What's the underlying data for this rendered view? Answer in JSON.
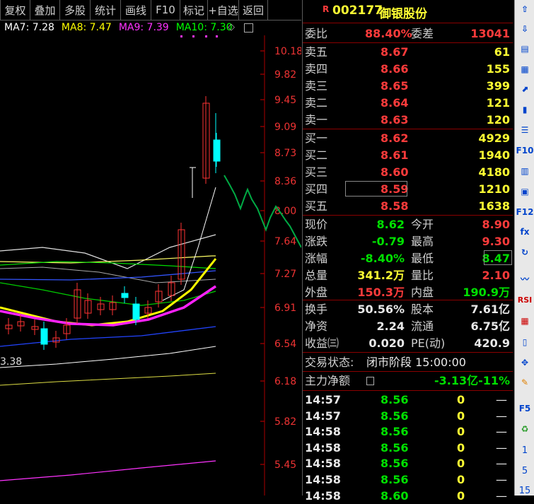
{
  "toolbar": [
    "复权",
    "叠加",
    "多股",
    "统计",
    "画线",
    "F10",
    "标记",
    "+自选",
    "返回"
  ],
  "ma": {
    "ma7": "MA7: 7.28",
    "ma8": "MA8: 7.47",
    "ma9": "MA9: 7.39",
    "ma10": "MA10: 7.30",
    "ma7_color": "#ffffff",
    "ma8_color": "#ffff00",
    "ma9_color": "#ff33ff",
    "ma10_color": "#00ff00"
  },
  "price_ticks": [
    "10.18",
    "9.82",
    "9.45",
    "9.09",
    "8.73",
    "8.36",
    "8.00",
    "7.64",
    "7.27",
    "6.91",
    "6.54",
    "6.18",
    "5.82",
    "5.45"
  ],
  "chart_low_label": "3.38",
  "stock": {
    "badge": "R",
    "code": "002177",
    "name": "御银股份"
  },
  "weibi": {
    "label1": "委比",
    "val1": "88.40%",
    "label2": "委差",
    "val2": "13041"
  },
  "sell": [
    {
      "label": "卖五",
      "price": "8.67",
      "vol": "61"
    },
    {
      "label": "卖四",
      "price": "8.66",
      "vol": "155"
    },
    {
      "label": "卖三",
      "price": "8.65",
      "vol": "399"
    },
    {
      "label": "卖二",
      "price": "8.64",
      "vol": "121"
    },
    {
      "label": "卖一",
      "price": "8.63",
      "vol": "120"
    }
  ],
  "buy": [
    {
      "label": "买一",
      "price": "8.62",
      "vol": "4929"
    },
    {
      "label": "买二",
      "price": "8.61",
      "vol": "1940"
    },
    {
      "label": "买三",
      "price": "8.60",
      "vol": "4180"
    },
    {
      "label": "买四",
      "price": "8.59",
      "vol": "1210"
    },
    {
      "label": "买五",
      "price": "8.58",
      "vol": "1638"
    }
  ],
  "quote": [
    {
      "l1": "现价",
      "v1": "8.62",
      "l2": "今开",
      "v2": "8.90"
    },
    {
      "l1": "涨跌",
      "v1": "-0.79",
      "l2": "最高",
      "v2": "9.30"
    },
    {
      "l1": "涨幅",
      "v1": "-8.40%",
      "l2": "最低",
      "v2": "8.47"
    },
    {
      "l1": "总量",
      "v1": "341.2万",
      "l2": "量比",
      "v2": "2.10"
    },
    {
      "l1": "外盘",
      "v1": "150.3万",
      "l2": "内盘",
      "v2": "190.9万"
    }
  ],
  "fin": [
    {
      "l1": "换手",
      "v1": "50.56%",
      "l2": "股本",
      "v2": "7.61亿"
    },
    {
      "l1": "净资",
      "v1": "2.24",
      "l2": "流通",
      "v2": "6.75亿"
    },
    {
      "l1": "收益㈢",
      "v1": "0.020",
      "l2": "PE(动)",
      "v2": "420.9"
    }
  ],
  "status": {
    "label": "交易状态:",
    "value": "闭市阶段 15:00:00"
  },
  "mainflow": {
    "label": "主力净额",
    "amount": "-3.13亿",
    "pct": "-11%"
  },
  "ticks": [
    {
      "time": "14:57",
      "price": "8.56",
      "vol": "0",
      "flag": "—"
    },
    {
      "time": "14:57",
      "price": "8.56",
      "vol": "0",
      "flag": "—"
    },
    {
      "time": "14:58",
      "price": "8.56",
      "vol": "0",
      "flag": "—"
    },
    {
      "time": "14:58",
      "price": "8.56",
      "vol": "0",
      "flag": "—"
    },
    {
      "time": "14:58",
      "price": "8.56",
      "vol": "0",
      "flag": "—"
    },
    {
      "time": "14:58",
      "price": "8.56",
      "vol": "0",
      "flag": "—"
    },
    {
      "time": "14:58",
      "price": "8.60",
      "vol": "0",
      "flag": "—"
    }
  ],
  "iconbar": [
    {
      "name": "up-arrow-icon",
      "glyph": "⇧"
    },
    {
      "name": "down-arrow-icon",
      "glyph": "⇩"
    },
    {
      "name": "minute-chart-icon",
      "glyph": "▤"
    },
    {
      "name": "table-icon",
      "glyph": "▦"
    },
    {
      "name": "trend-icon",
      "glyph": "⬈"
    },
    {
      "name": "candlestick-icon",
      "glyph": "▮"
    },
    {
      "name": "list-icon",
      "glyph": "☰"
    },
    {
      "name": "f10-icon",
      "glyph": "F10"
    },
    {
      "name": "chart-window-icon",
      "glyph": "▥"
    },
    {
      "name": "note-icon",
      "glyph": "▣"
    },
    {
      "name": "f12-icon",
      "glyph": "F12"
    },
    {
      "name": "fx-icon",
      "glyph": "fx"
    },
    {
      "name": "refresh-icon",
      "glyph": "↻"
    },
    {
      "name": "wave-icon",
      "glyph": "〰"
    },
    {
      "name": "rsi-icon",
      "glyph": "RSI"
    },
    {
      "name": "calendar-icon",
      "glyph": "▦"
    },
    {
      "name": "phone-icon",
      "glyph": "▯"
    },
    {
      "name": "move-icon",
      "glyph": "✥"
    },
    {
      "name": "pencil-icon",
      "glyph": "✎"
    },
    {
      "name": "f5-icon",
      "glyph": "F5"
    },
    {
      "name": "recycle-icon",
      "glyph": "♻"
    },
    {
      "name": "page-1",
      "glyph": "1"
    },
    {
      "name": "page-5",
      "glyph": "5"
    },
    {
      "name": "page-15",
      "glyph": "15"
    }
  ]
}
